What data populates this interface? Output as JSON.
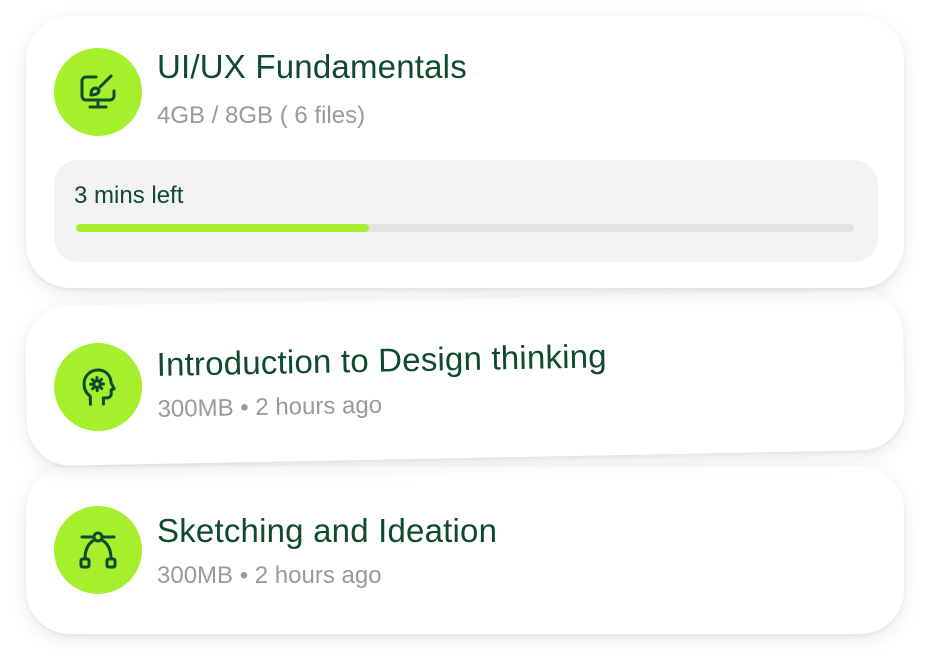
{
  "theme": {
    "accent": "#a6ef2c",
    "title_color": "#0d4a2e",
    "meta_color": "#9a9a9a",
    "card_background": "#ffffff",
    "progress_box_background": "#f3f3f3"
  },
  "items": [
    {
      "icon": "monitor-brush-icon",
      "title": "UI/UX Fundamentals",
      "meta": "4GB / 8GB ( 6 files)",
      "progress": {
        "label": "3 mins left",
        "fraction": 0.376
      }
    },
    {
      "icon": "head-gear-icon",
      "title": "Introduction to Design thinking",
      "meta": "300MB • 2 hours ago"
    },
    {
      "icon": "vector-pen-icon",
      "title": "Sketching and Ideation",
      "meta": "300MB • 2 hours ago"
    }
  ]
}
